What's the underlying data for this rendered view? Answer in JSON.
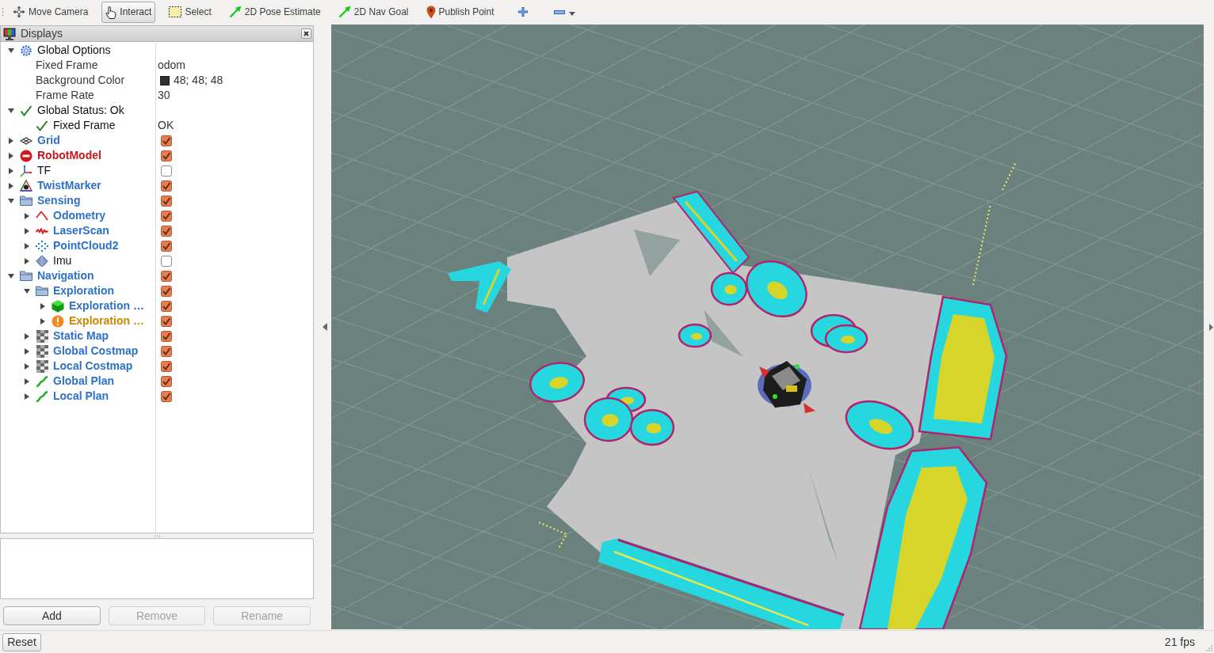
{
  "toolbar": {
    "tools": [
      {
        "label": "Move Camera",
        "kind": "move",
        "selected": false
      },
      {
        "label": "Interact",
        "kind": "interact",
        "selected": true
      },
      {
        "label": "Select",
        "kind": "select",
        "selected": false
      },
      {
        "label": "2D Pose Estimate",
        "kind": "pose",
        "selected": false
      },
      {
        "label": "2D Nav Goal",
        "kind": "goal",
        "selected": false
      },
      {
        "label": "Publish Point",
        "kind": "point",
        "selected": false
      }
    ]
  },
  "displays_panel": {
    "title": "Displays",
    "tree": [
      {
        "label": "Global Options",
        "kind": "options",
        "expanded": true,
        "children": [
          {
            "label": "Fixed Frame",
            "kind": "property",
            "value": "odom"
          },
          {
            "label": "Background Color",
            "kind": "property",
            "value": "48; 48; 48",
            "color": "#303030"
          },
          {
            "label": "Frame Rate",
            "kind": "property",
            "value": "30"
          }
        ]
      },
      {
        "label": "Global Status: Ok",
        "kind": "status",
        "expanded": true,
        "children": [
          {
            "label": "Fixed Frame",
            "kind": "status",
            "value": "OK"
          }
        ]
      },
      {
        "label": "Grid",
        "kind": "grid",
        "error": false,
        "warning": false,
        "expanded": false,
        "checked": true
      },
      {
        "label": "RobotModel",
        "kind": "robot",
        "error": true,
        "warning": false,
        "expanded": false,
        "checked": true
      },
      {
        "label": "TF",
        "kind": "tf",
        "error": false,
        "warning": false,
        "expanded": false,
        "checked": false
      },
      {
        "label": "TwistMarker",
        "kind": "marker",
        "error": false,
        "warning": false,
        "expanded": false,
        "checked": true
      },
      {
        "label": "Sensing",
        "kind": "folder",
        "error": false,
        "warning": false,
        "expanded": true,
        "checked": true,
        "children": [
          {
            "label": "Odometry",
            "kind": "odometry",
            "error": false,
            "warning": false,
            "expanded": false,
            "checked": true
          },
          {
            "label": "LaserScan",
            "kind": "laser",
            "error": false,
            "warning": false,
            "expanded": false,
            "checked": true
          },
          {
            "label": "PointCloud2",
            "kind": "cloud",
            "error": false,
            "warning": false,
            "expanded": false,
            "checked": true
          },
          {
            "label": "Imu",
            "kind": "imu",
            "error": false,
            "warning": false,
            "expanded": false,
            "checked": false
          }
        ]
      },
      {
        "label": "Navigation",
        "kind": "folder",
        "error": false,
        "warning": false,
        "expanded": true,
        "checked": true,
        "children": [
          {
            "label": "Exploration",
            "kind": "folder",
            "error": false,
            "warning": false,
            "expanded": true,
            "checked": true,
            "children": [
              {
                "label": "Exploration …",
                "kind": "cube",
                "error": false,
                "warning": false,
                "expanded": false,
                "checked": true
              },
              {
                "label": "Exploration …",
                "kind": "marker",
                "error": false,
                "warning": true,
                "expanded": false,
                "checked": true
              }
            ]
          },
          {
            "label": "Static Map",
            "kind": "map",
            "error": false,
            "warning": false,
            "expanded": false,
            "checked": true
          },
          {
            "label": "Global Costmap",
            "kind": "map",
            "error": false,
            "warning": false,
            "expanded": false,
            "checked": true
          },
          {
            "label": "Local Costmap",
            "kind": "map",
            "error": false,
            "warning": false,
            "expanded": false,
            "checked": true
          },
          {
            "label": "Global Plan",
            "kind": "path",
            "error": false,
            "warning": false,
            "expanded": false,
            "checked": true
          },
          {
            "label": "Local Plan",
            "kind": "path",
            "error": false,
            "warning": false,
            "expanded": false,
            "checked": true
          }
        ]
      }
    ],
    "buttons": [
      {
        "label": "Add",
        "disabled": false
      },
      {
        "label": "Remove",
        "disabled": true
      },
      {
        "label": "Rename",
        "disabled": true
      }
    ]
  },
  "status_bar": {
    "button": "Reset",
    "fps": "21 fps"
  }
}
